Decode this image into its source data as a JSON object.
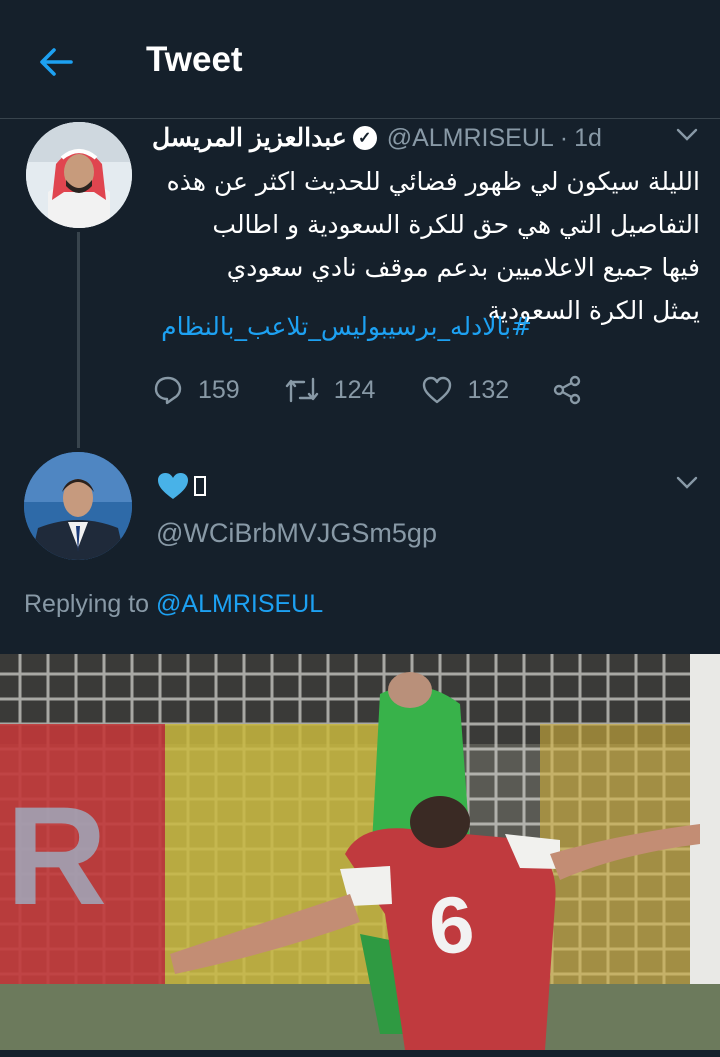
{
  "header": {
    "title": "Tweet"
  },
  "parent_tweet": {
    "display_name": "عبدالعزيز المريسل",
    "handle": "@ALMRISEUL",
    "separator": "·",
    "time": "1d",
    "text_lines": [
      "الليلة سيكون لي ظهور فضائي للحديث اكثر عن هذه",
      "التفاصيل التي هي حق للكرة السعودية و اطالب",
      "فيها جميع الاعلاميين بدعم موقف نادي سعودي",
      "يمثل الكرة السعودية"
    ],
    "hashtag": "#بالادله_برسيبوليس_تلاعب_بالنظام",
    "replies": "159",
    "retweets": "124",
    "likes": "132"
  },
  "reply_tweet": {
    "display_name_icon": "blue-heart-icon",
    "handle": "@WCiBrbMVJGSm5gp",
    "replying_prefix": "Replying to",
    "replying_to": "@ALMRISEUL"
  },
  "media": {
    "jersey_number": "6"
  },
  "colors": {
    "background": "#15202b",
    "accent": "#1da1f2",
    "muted": "#8899a6",
    "divider": "#38444d"
  }
}
